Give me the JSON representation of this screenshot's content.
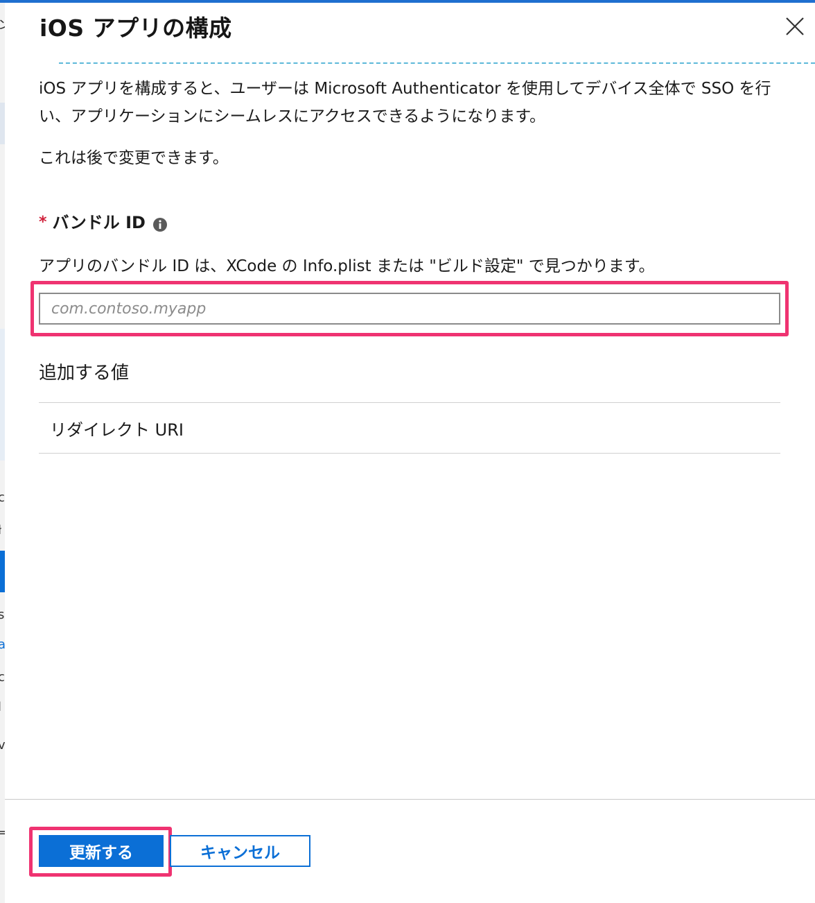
{
  "window": {
    "accent_color": "#1f6fcf"
  },
  "background": {
    "chars": [
      "ン",
      "c",
      "ł",
      "n",
      "s",
      "a",
      "c",
      "l",
      "vi",
      "="
    ]
  },
  "panel": {
    "title": "iOS アプリの構成",
    "close_icon": "close-icon",
    "description": "iOS アプリを構成すると、ユーザーは Microsoft Authenticator を使用してデバイス全体で SSO を行い、アプリケーションにシームレスにアクセスできるようになります。",
    "note": "これは後で変更できます。"
  },
  "bundle_field": {
    "required_mark": "*",
    "label": "バンドル ID",
    "info_icon": "info-icon",
    "help": "アプリのバンドル ID は、XCode の Info.plist または \"ビルド設定\" で見つかります。",
    "value": "",
    "placeholder": "com.contoso.myapp",
    "highlight_color": "#ef3371"
  },
  "added_values": {
    "title": "追加する値",
    "rows": [
      {
        "label": "リダイレクト URI"
      }
    ]
  },
  "footer": {
    "primary_label": "更新する",
    "secondary_label": "キャンセル",
    "button_color": "#0b6fd6"
  }
}
